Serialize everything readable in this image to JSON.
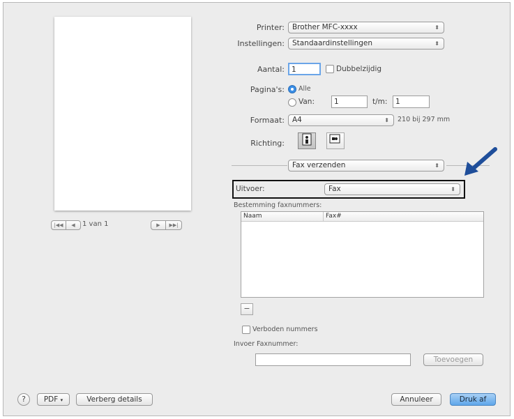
{
  "preview": {
    "nav_first": "|◀◀",
    "nav_prev": "◀",
    "page_info": "1 van 1",
    "nav_next": "▶",
    "nav_last": "▶▶|"
  },
  "printer": {
    "label": "Printer:",
    "value": "Brother MFC-xxxx"
  },
  "settings": {
    "label": "Instellingen:",
    "value": "Standaardinstellingen"
  },
  "copies": {
    "label": "Aantal:",
    "value": "1",
    "duplex_label": "Dubbelzijdig"
  },
  "pages": {
    "label": "Pagina's:",
    "all_label": "Alle",
    "from_label": "Van:",
    "from_value": "1",
    "to_label": "t/m:",
    "to_value": "1"
  },
  "paper": {
    "label": "Formaat:",
    "value": "A4",
    "size_text": "210 bij 297 mm"
  },
  "orientation": {
    "label": "Richting:"
  },
  "section_popup": "Fax verzenden",
  "output": {
    "label": "Uitvoer:",
    "value": "Fax"
  },
  "recipients": {
    "label": "Bestemming faxnummers:",
    "columns": [
      "Naam",
      "Fax#"
    ],
    "remove_label": "−"
  },
  "forbidden_numbers": "Verboden nummers",
  "fax_entry": {
    "label": "Invoer Faxnummer:",
    "value": "",
    "add_button": "Toevoegen"
  },
  "footer": {
    "help": "?",
    "pdf_button": "PDF",
    "hide_details": "Verberg details",
    "cancel": "Annuleer",
    "print": "Druk af"
  }
}
